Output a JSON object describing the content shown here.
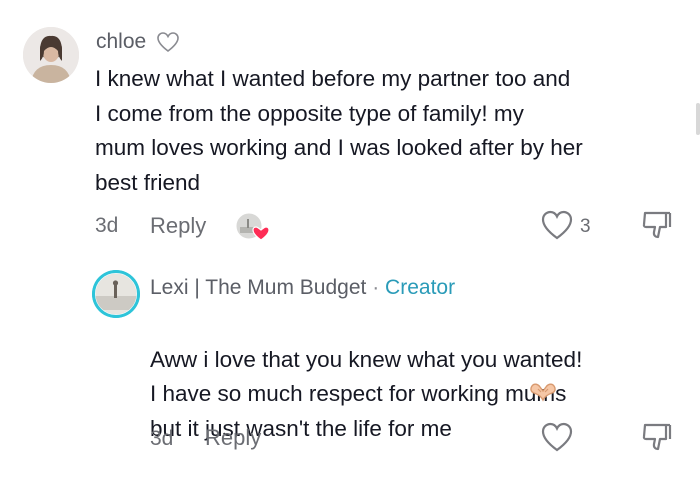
{
  "comments": [
    {
      "username": "chloe",
      "text": "I knew what I wanted before my partner too and\nI come from the opposite type of family! my\nmum loves working and I was looked after by her\nbest friend",
      "age": "3d",
      "reply_label": "Reply",
      "like_count": "3",
      "icons": [
        "heart-outline-icon",
        "creator-liked-avatar-icon",
        "heart-outline-icon",
        "dislike-icon"
      ]
    },
    {
      "username": "Lexi | The Mum Budget",
      "separator": "·",
      "badge": "Creator",
      "text": "Aww i love that you knew what you wanted!\nI have so much respect for working mums\nbut it just wasn't the life for me",
      "emoji_name": "heart-hands-icon",
      "age": "3d",
      "reply_label": "Reply",
      "icons": [
        "heart-outline-icon",
        "dislike-icon"
      ]
    }
  ],
  "colors": {
    "text": "#161823",
    "meta": "#6b6d73",
    "creator": "#2a9bb8",
    "liked_heart": "#fe2c55",
    "avatar_ring": "#2ec4d9"
  }
}
